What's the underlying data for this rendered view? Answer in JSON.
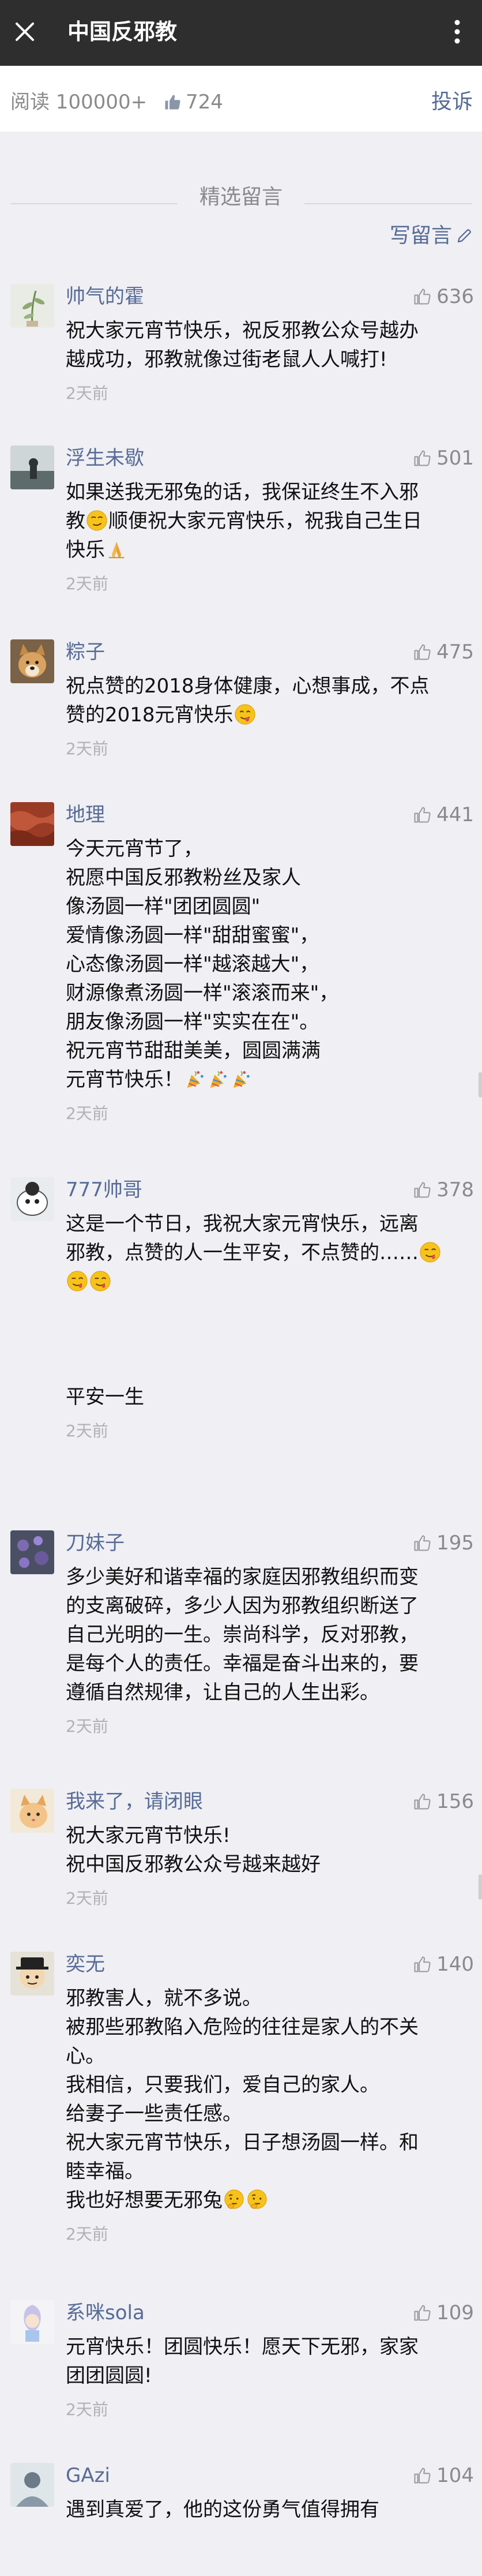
{
  "header": {
    "title": "中国反邪教",
    "close_icon": "close-icon",
    "more_icon": "more-vertical-icon",
    "background": "#2e2e2e"
  },
  "stats": {
    "reads": "阅读 100000+",
    "likes": "724",
    "report": "投诉"
  },
  "section": {
    "title": "精选留言",
    "write": "写留言"
  },
  "colors": {
    "link": "#576b95",
    "gray": "#8a8a8a",
    "background": "#efeff4"
  },
  "comments": [
    {
      "nickname": "帅气的霍",
      "likes": "636",
      "lines": [
        "祝大家元宵节快乐，祝反邪教公众号越办",
        "越成功，邪教就像过街老鼠人人喊打!"
      ],
      "time": "2天前"
    },
    {
      "nickname": "浮生未歇",
      "likes": "501",
      "lines": [
        "如果送我无邪兔的话，我保证终生不入邪",
        "教",
        "顺便祝大家元宵快乐，祝我自己生日",
        "快乐"
      ],
      "time": "2天前"
    },
    {
      "nickname": "粽子",
      "likes": "475",
      "lines": [
        "祝点赞的2018身体健康，心想事成，不点",
        "赞的2018元宵快乐"
      ],
      "time": "2天前"
    },
    {
      "nickname": "地理",
      "likes": "441",
      "lines": [
        "今天元宵节了，",
        "祝愿中国反邪教粉丝及家人",
        "像汤圆一样\"团团圆圆\"",
        "爱情像汤圆一样\"甜甜蜜蜜\"，",
        "心态像汤圆一样\"越滚越大\"，",
        "财源像煮汤圆一样\"滚滚而来\"，",
        "朋友像汤圆一样\"实实在在\"。",
        "祝元宵节甜甜美美，圆圆满满",
        "元宵节快乐！"
      ],
      "time": "2天前"
    },
    {
      "nickname": "777帅哥",
      "likes": "378",
      "lines": [
        "这是一个节日，我祝大家元宵快乐，远离",
        "邪教，点赞的人一生平安，不点赞的……",
        "平安一生"
      ],
      "time": "2天前"
    },
    {
      "nickname": "刀妹子",
      "likes": "195",
      "lines": [
        "多少美好和谐幸福的家庭因邪教组织而变",
        "的支离破碎，多少人因为邪教组织断送了",
        "自己光明的一生。崇尚科学，反对邪教，",
        "是每个人的责任。幸福是奋斗出来的，要",
        "遵循自然规律，让自己的人生出彩。"
      ],
      "time": "2天前"
    },
    {
      "nickname": "我来了，请闭眼",
      "likes": "156",
      "lines": [
        "祝大家元宵节快乐!",
        "祝中国反邪教公众号越来越好"
      ],
      "time": "2天前"
    },
    {
      "nickname": "奕无",
      "likes": "140",
      "lines": [
        "邪教害人，就不多说。",
        "被那些邪教陷入危险的往往是家人的不关",
        "心。",
        "我相信，只要我们，爱自己的家人。",
        "给妻子一些责任感。",
        "祝大家元宵节快乐，日子想汤圆一样。和",
        "睦幸福。",
        "我也好想要无邪兔"
      ],
      "time": "2天前"
    },
    {
      "nickname": "系咪sola",
      "likes": "109",
      "lines": [
        "元宵快乐！团圆快乐！愿天下无邪，家家",
        "团团圆圆!"
      ],
      "time": "2天前"
    },
    {
      "nickname": "GAzi",
      "likes": "104",
      "lines": [
        "遇到真爱了，他的这份勇气值得拥有"
      ],
      "time": ""
    }
  ]
}
